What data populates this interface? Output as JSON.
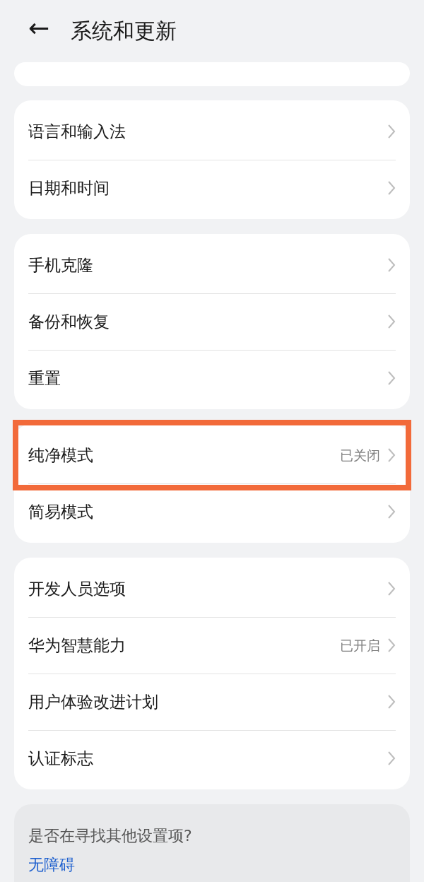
{
  "header": {
    "back_icon": "←",
    "title": "系统和更新"
  },
  "sections": [
    {
      "rows": [
        {
          "label": "语言和输入法",
          "highlighted": false
        },
        {
          "label": "日期和时间",
          "highlighted": false
        }
      ]
    },
    {
      "rows": [
        {
          "label": "手机克隆",
          "highlighted": false
        },
        {
          "label": "备份和恢复",
          "highlighted": false
        },
        {
          "label": "重置",
          "highlighted": false
        }
      ]
    },
    {
      "rows": [
        {
          "label": "纯净模式",
          "value": "已关闭",
          "highlighted": true
        },
        {
          "label": "简易模式",
          "highlighted": false
        }
      ]
    },
    {
      "rows": [
        {
          "label": "开发人员选项",
          "highlighted": false
        },
        {
          "label": "华为智慧能力",
          "value": "已开启",
          "highlighted": false
        },
        {
          "label": "用户体验改进计划",
          "highlighted": false
        },
        {
          "label": "认证标志",
          "highlighted": false
        }
      ]
    }
  ],
  "suggestions": {
    "title": "是否在寻找其他设置项?",
    "links": [
      "无障碍"
    ]
  }
}
